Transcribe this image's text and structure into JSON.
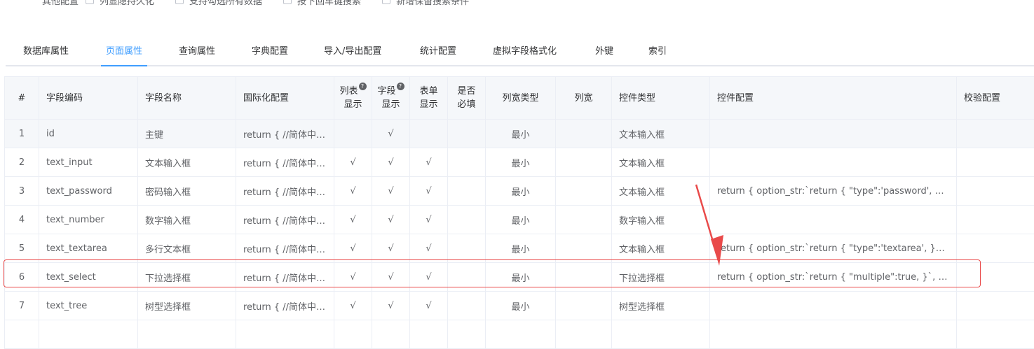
{
  "options": {
    "label": "其他配置",
    "items": [
      "列显隐持久化",
      "支持勾选所有数据",
      "按下回车键搜索",
      "新增保留搜索条件"
    ]
  },
  "tabs": [
    "数据库属性",
    "页面属性",
    "查询属性",
    "字典配置",
    "导入/导出配置",
    "统计配置",
    "虚拟字段格式化",
    "外键",
    "索引"
  ],
  "active_tab": "页面属性",
  "columns": {
    "index": "#",
    "code": "字段编码",
    "name": "字段名称",
    "i18n": "国际化配置",
    "list_show_1": "列表",
    "list_show_2": "显示",
    "field_show_1": "字段",
    "field_show_2": "显示",
    "form_show_1": "表单",
    "form_show_2": "显示",
    "required_1": "是否",
    "required_2": "必填",
    "width_type": "列宽类型",
    "width": "列宽",
    "widget_type": "控件类型",
    "widget_config": "控件配置",
    "validate_config": "校验配置",
    "help_icon": "?"
  },
  "rows": [
    {
      "idx": "1",
      "code": "id",
      "name": "主键",
      "i18n": "return { //简体中文...",
      "list": "",
      "field": "√",
      "form": "",
      "req": "",
      "wtype": "最小",
      "width": "",
      "widget": "文本输入框",
      "cfg": "",
      "val": ""
    },
    {
      "idx": "2",
      "code": "text_input",
      "name": "文本输入框",
      "i18n": "return { //简体中文...",
      "list": "√",
      "field": "√",
      "form": "√",
      "req": "",
      "wtype": "最小",
      "width": "",
      "widget": "文本输入框",
      "cfg": "",
      "val": ""
    },
    {
      "idx": "3",
      "code": "text_password",
      "name": "密码输入框",
      "i18n": "return { //简体中文...",
      "list": "√",
      "field": "√",
      "form": "√",
      "req": "",
      "wtype": "最小",
      "width": "",
      "widget": "文本输入框",
      "cfg": "return { option_str:`return { \"type\":'password', }`, custom...",
      "val": ""
    },
    {
      "idx": "4",
      "code": "text_number",
      "name": "数字输入框",
      "i18n": "return { //简体中文...",
      "list": "√",
      "field": "√",
      "form": "√",
      "req": "",
      "wtype": "最小",
      "width": "",
      "widget": "数字输入框",
      "cfg": "",
      "val": ""
    },
    {
      "idx": "5",
      "code": "text_textarea",
      "name": "多行文本框",
      "i18n": "return { //简体中文...",
      "list": "√",
      "field": "√",
      "form": "√",
      "req": "",
      "wtype": "最小",
      "width": "",
      "widget": "文本输入框",
      "cfg": "return { option_str:`return { \"type\":'textarea', }`, custom_s...",
      "val": ""
    },
    {
      "idx": "6",
      "code": "text_select",
      "name": "下拉选择框",
      "i18n": "return { //简体中文...",
      "list": "√",
      "field": "√",
      "form": "√",
      "req": "",
      "wtype": "最小",
      "width": "",
      "widget": "下拉选择框",
      "cfg": "return { option_str:`return { \"multiple\":true, }`, custom_st...",
      "val": ""
    },
    {
      "idx": "7",
      "code": "text_tree",
      "name": "树型选择框",
      "i18n": "return { //简体中文...",
      "list": "√",
      "field": "√",
      "form": "√",
      "req": "",
      "wtype": "最小",
      "width": "",
      "widget": "树型选择框",
      "cfg": "",
      "val": ""
    },
    {
      "idx": "",
      "code": "",
      "name": "",
      "i18n": "",
      "list": "",
      "field": "",
      "form": "",
      "req": "",
      "wtype": "",
      "width": "",
      "widget": "",
      "cfg": "",
      "val": ""
    }
  ],
  "annotation_color": "#e94a4a",
  "accent_color": "#409eff"
}
